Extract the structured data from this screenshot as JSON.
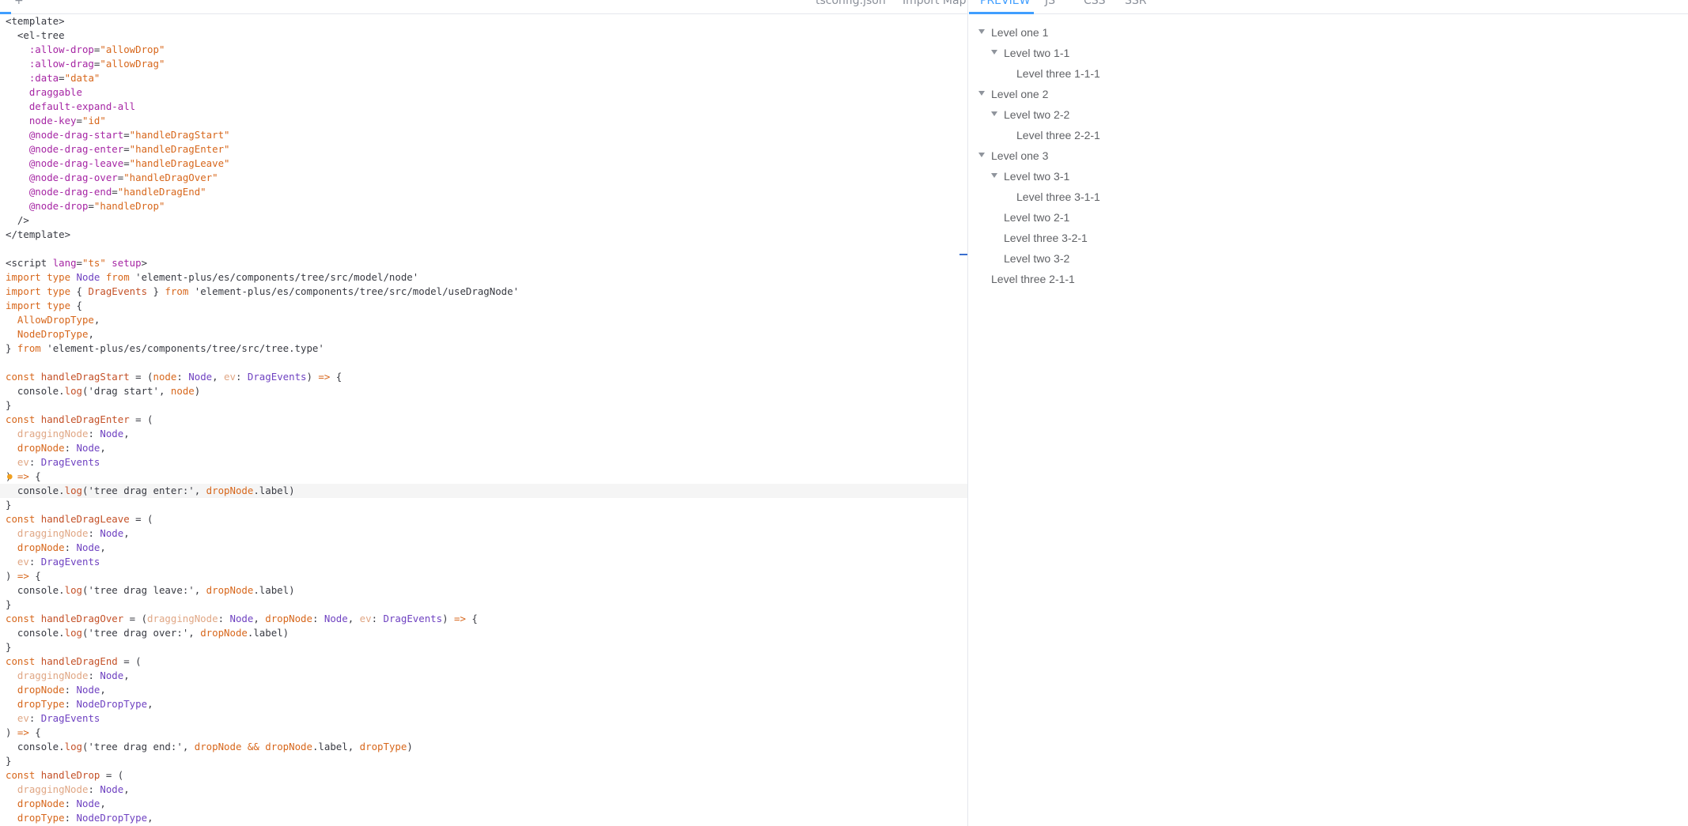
{
  "editor": {
    "tabs": [
      "+",
      "tsconfig.json",
      "Import Map"
    ],
    "code": [
      [
        [
          "tk-tag",
          "<template>"
        ]
      ],
      [
        [
          "tk-tag",
          "  <el-tree"
        ]
      ],
      [
        [
          "tk-attr",
          "    :allow-drop"
        ],
        [
          "tk-plain",
          "="
        ],
        [
          "tk-str",
          "\"allowDrop\""
        ]
      ],
      [
        [
          "tk-attr",
          "    :allow-drag"
        ],
        [
          "tk-plain",
          "="
        ],
        [
          "tk-str",
          "\"allowDrag\""
        ]
      ],
      [
        [
          "tk-attr",
          "    :data"
        ],
        [
          "tk-plain",
          "="
        ],
        [
          "tk-str",
          "\"data\""
        ]
      ],
      [
        [
          "tk-attr",
          "    draggable"
        ]
      ],
      [
        [
          "tk-attr",
          "    default-expand-all"
        ]
      ],
      [
        [
          "tk-attr",
          "    node-key"
        ],
        [
          "tk-plain",
          "="
        ],
        [
          "tk-str",
          "\"id\""
        ]
      ],
      [
        [
          "tk-attr",
          "    @node-drag-start"
        ],
        [
          "tk-plain",
          "="
        ],
        [
          "tk-str",
          "\"handleDragStart\""
        ]
      ],
      [
        [
          "tk-attr",
          "    @node-drag-enter"
        ],
        [
          "tk-plain",
          "="
        ],
        [
          "tk-str",
          "\"handleDragEnter\""
        ]
      ],
      [
        [
          "tk-attr",
          "    @node-drag-leave"
        ],
        [
          "tk-plain",
          "="
        ],
        [
          "tk-str",
          "\"handleDragLeave\""
        ]
      ],
      [
        [
          "tk-attr",
          "    @node-drag-over"
        ],
        [
          "tk-plain",
          "="
        ],
        [
          "tk-str",
          "\"handleDragOver\""
        ]
      ],
      [
        [
          "tk-attr",
          "    @node-drag-end"
        ],
        [
          "tk-plain",
          "="
        ],
        [
          "tk-str",
          "\"handleDragEnd\""
        ]
      ],
      [
        [
          "tk-attr",
          "    @node-drop"
        ],
        [
          "tk-plain",
          "="
        ],
        [
          "tk-str",
          "\"handleDrop\""
        ]
      ],
      [
        [
          "tk-tag",
          "  />"
        ]
      ],
      [
        [
          "tk-tag",
          "</template>"
        ]
      ],
      [],
      [
        [
          "tk-tag",
          "<script "
        ],
        [
          "tk-attr",
          "lang"
        ],
        [
          "tk-plain",
          "="
        ],
        [
          "tk-str",
          "\"ts\""
        ],
        [
          "tk-attr",
          " setup"
        ],
        [
          "tk-tag",
          ">"
        ]
      ],
      [
        [
          "tk-kw",
          "import type "
        ],
        [
          "tk-type",
          "Node"
        ],
        [
          "tk-kw",
          " from "
        ],
        [
          "tk-plain",
          "'element-plus/es/components/tree/src/model/node'"
        ]
      ],
      [
        [
          "tk-kw",
          "import type "
        ],
        [
          "tk-plain",
          "{ "
        ],
        [
          "tk-fn",
          "DragEvents"
        ],
        [
          "tk-plain",
          " } "
        ],
        [
          "tk-kw",
          "from "
        ],
        [
          "tk-plain",
          "'element-plus/es/components/tree/src/model/useDragNode'"
        ]
      ],
      [
        [
          "tk-kw",
          "import type "
        ],
        [
          "tk-plain",
          "{"
        ]
      ],
      [
        [
          "tk-var",
          "  AllowDropType"
        ],
        [
          "tk-plain",
          ","
        ]
      ],
      [
        [
          "tk-var",
          "  NodeDropType"
        ],
        [
          "tk-plain",
          ","
        ]
      ],
      [
        [
          "tk-plain",
          "} "
        ],
        [
          "tk-kw",
          "from "
        ],
        [
          "tk-plain",
          "'element-plus/es/components/tree/src/tree.type'"
        ]
      ],
      [],
      [
        [
          "tk-kw",
          "const "
        ],
        [
          "tk-fn",
          "handleDragStart"
        ],
        [
          "tk-plain",
          " = ("
        ],
        [
          "tk-var",
          "node"
        ],
        [
          "tk-plain",
          ": "
        ],
        [
          "tk-type",
          "Node"
        ],
        [
          "tk-plain",
          ", "
        ],
        [
          "tk-param",
          "ev"
        ],
        [
          "tk-plain",
          ": "
        ],
        [
          "tk-type",
          "DragEvents"
        ],
        [
          "tk-plain",
          ") "
        ],
        [
          "tk-kw",
          "=>"
        ],
        [
          "tk-plain",
          " {"
        ]
      ],
      [
        [
          "tk-plain",
          "  console."
        ],
        [
          "tk-fn",
          "log"
        ],
        [
          "tk-plain",
          "('drag start', "
        ],
        [
          "tk-var",
          "node"
        ],
        [
          "tk-plain",
          ")"
        ]
      ],
      [
        [
          "tk-plain",
          "}"
        ]
      ],
      [
        [
          "tk-kw",
          "const "
        ],
        [
          "tk-fn",
          "handleDragEnter"
        ],
        [
          "tk-plain",
          " = ("
        ]
      ],
      [
        [
          "tk-param",
          "  draggingNode"
        ],
        [
          "tk-plain",
          ": "
        ],
        [
          "tk-type",
          "Node"
        ],
        [
          "tk-plain",
          ","
        ]
      ],
      [
        [
          "tk-var",
          "  dropNode"
        ],
        [
          "tk-plain",
          ": "
        ],
        [
          "tk-type",
          "Node"
        ],
        [
          "tk-plain",
          ","
        ]
      ],
      [
        [
          "tk-param",
          "  ev"
        ],
        [
          "tk-plain",
          ": "
        ],
        [
          "tk-type",
          "DragEvents"
        ]
      ],
      [
        [
          "tk-plain",
          ") "
        ],
        [
          "tk-kw",
          "=>"
        ],
        [
          "tk-plain",
          " {"
        ]
      ],
      [
        [
          "tk-plain",
          "  console."
        ],
        [
          "tk-fn",
          "log"
        ],
        [
          "tk-plain",
          "('tree drag enter:', "
        ],
        [
          "tk-var",
          "dropNode"
        ],
        [
          "tk-plain",
          ".label)"
        ]
      ],
      [
        [
          "tk-plain",
          "}"
        ]
      ],
      [
        [
          "tk-kw",
          "const "
        ],
        [
          "tk-fn",
          "handleDragLeave"
        ],
        [
          "tk-plain",
          " = ("
        ]
      ],
      [
        [
          "tk-param",
          "  draggingNode"
        ],
        [
          "tk-plain",
          ": "
        ],
        [
          "tk-type",
          "Node"
        ],
        [
          "tk-plain",
          ","
        ]
      ],
      [
        [
          "tk-var",
          "  dropNode"
        ],
        [
          "tk-plain",
          ": "
        ],
        [
          "tk-type",
          "Node"
        ],
        [
          "tk-plain",
          ","
        ]
      ],
      [
        [
          "tk-param",
          "  ev"
        ],
        [
          "tk-plain",
          ": "
        ],
        [
          "tk-type",
          "DragEvents"
        ]
      ],
      [
        [
          "tk-plain",
          ") "
        ],
        [
          "tk-kw",
          "=>"
        ],
        [
          "tk-plain",
          " {"
        ]
      ],
      [
        [
          "tk-plain",
          "  console."
        ],
        [
          "tk-fn",
          "log"
        ],
        [
          "tk-plain",
          "('tree drag leave:', "
        ],
        [
          "tk-var",
          "dropNode"
        ],
        [
          "tk-plain",
          ".label)"
        ]
      ],
      [
        [
          "tk-plain",
          "}"
        ]
      ],
      [
        [
          "tk-kw",
          "const "
        ],
        [
          "tk-fn",
          "handleDragOver"
        ],
        [
          "tk-plain",
          " = ("
        ],
        [
          "tk-param",
          "draggingNode"
        ],
        [
          "tk-plain",
          ": "
        ],
        [
          "tk-type",
          "Node"
        ],
        [
          "tk-plain",
          ", "
        ],
        [
          "tk-var",
          "dropNode"
        ],
        [
          "tk-plain",
          ": "
        ],
        [
          "tk-type",
          "Node"
        ],
        [
          "tk-plain",
          ", "
        ],
        [
          "tk-param",
          "ev"
        ],
        [
          "tk-plain",
          ": "
        ],
        [
          "tk-type",
          "DragEvents"
        ],
        [
          "tk-plain",
          ") "
        ],
        [
          "tk-kw",
          "=>"
        ],
        [
          "tk-plain",
          " {"
        ]
      ],
      [
        [
          "tk-plain",
          "  console."
        ],
        [
          "tk-fn",
          "log"
        ],
        [
          "tk-plain",
          "('tree drag over:', "
        ],
        [
          "tk-var",
          "dropNode"
        ],
        [
          "tk-plain",
          ".label)"
        ]
      ],
      [
        [
          "tk-plain",
          "}"
        ]
      ],
      [
        [
          "tk-kw",
          "const "
        ],
        [
          "tk-fn",
          "handleDragEnd"
        ],
        [
          "tk-plain",
          " = ("
        ]
      ],
      [
        [
          "tk-param",
          "  draggingNode"
        ],
        [
          "tk-plain",
          ": "
        ],
        [
          "tk-type",
          "Node"
        ],
        [
          "tk-plain",
          ","
        ]
      ],
      [
        [
          "tk-var",
          "  dropNode"
        ],
        [
          "tk-plain",
          ": "
        ],
        [
          "tk-type",
          "Node"
        ],
        [
          "tk-plain",
          ","
        ]
      ],
      [
        [
          "tk-var",
          "  dropType"
        ],
        [
          "tk-plain",
          ": "
        ],
        [
          "tk-type",
          "NodeDropType"
        ],
        [
          "tk-plain",
          ","
        ]
      ],
      [
        [
          "tk-param",
          "  ev"
        ],
        [
          "tk-plain",
          ": "
        ],
        [
          "tk-type",
          "DragEvents"
        ]
      ],
      [
        [
          "tk-plain",
          ") "
        ],
        [
          "tk-kw",
          "=>"
        ],
        [
          "tk-plain",
          " {"
        ]
      ],
      [
        [
          "tk-plain",
          "  console."
        ],
        [
          "tk-fn",
          "log"
        ],
        [
          "tk-plain",
          "('tree drag end:', "
        ],
        [
          "tk-var",
          "dropNode"
        ],
        [
          "tk-kw",
          " && "
        ],
        [
          "tk-var",
          "dropNode"
        ],
        [
          "tk-plain",
          ".label, "
        ],
        [
          "tk-var",
          "dropType"
        ],
        [
          "tk-plain",
          ")"
        ]
      ],
      [
        [
          "tk-plain",
          "}"
        ]
      ],
      [
        [
          "tk-kw",
          "const "
        ],
        [
          "tk-fn",
          "handleDrop"
        ],
        [
          "tk-plain",
          " = ("
        ]
      ],
      [
        [
          "tk-param",
          "  draggingNode"
        ],
        [
          "tk-plain",
          ": "
        ],
        [
          "tk-type",
          "Node"
        ],
        [
          "tk-plain",
          ","
        ]
      ],
      [
        [
          "tk-var",
          "  dropNode"
        ],
        [
          "tk-plain",
          ": "
        ],
        [
          "tk-type",
          "Node"
        ],
        [
          "tk-plain",
          ","
        ]
      ],
      [
        [
          "tk-var",
          "  dropType"
        ],
        [
          "tk-plain",
          ": "
        ],
        [
          "tk-type",
          "NodeDropType"
        ],
        [
          "tk-plain",
          ","
        ]
      ]
    ]
  },
  "preview": {
    "tabs": [
      "PREVIEW",
      "JS",
      "CSS",
      "SSR"
    ],
    "tree": [
      {
        "label": "Level one 1",
        "level": 0,
        "expandable": true
      },
      {
        "label": "Level two 1-1",
        "level": 1,
        "expandable": true
      },
      {
        "label": "Level three 1-1-1",
        "level": 2,
        "expandable": false
      },
      {
        "label": "Level one 2",
        "level": 0,
        "expandable": true
      },
      {
        "label": "Level two 2-2",
        "level": 1,
        "expandable": true
      },
      {
        "label": "Level three 2-2-1",
        "level": 2,
        "expandable": false
      },
      {
        "label": "Level one 3",
        "level": 0,
        "expandable": true
      },
      {
        "label": "Level two 3-1",
        "level": 1,
        "expandable": true
      },
      {
        "label": "Level three 3-1-1",
        "level": 2,
        "expandable": false
      },
      {
        "label": "Level two 2-1",
        "level": 1,
        "expandable": false
      },
      {
        "label": "Level three 3-2-1",
        "level": 1,
        "expandable": false
      },
      {
        "label": "Level two 3-2",
        "level": 1,
        "expandable": false
      },
      {
        "label": "Level three 2-1-1",
        "level": 0,
        "expandable": false
      }
    ]
  },
  "colors": {
    "accent": "#409eff",
    "divider": "#e4e7ed",
    "tree_text": "#606266"
  }
}
